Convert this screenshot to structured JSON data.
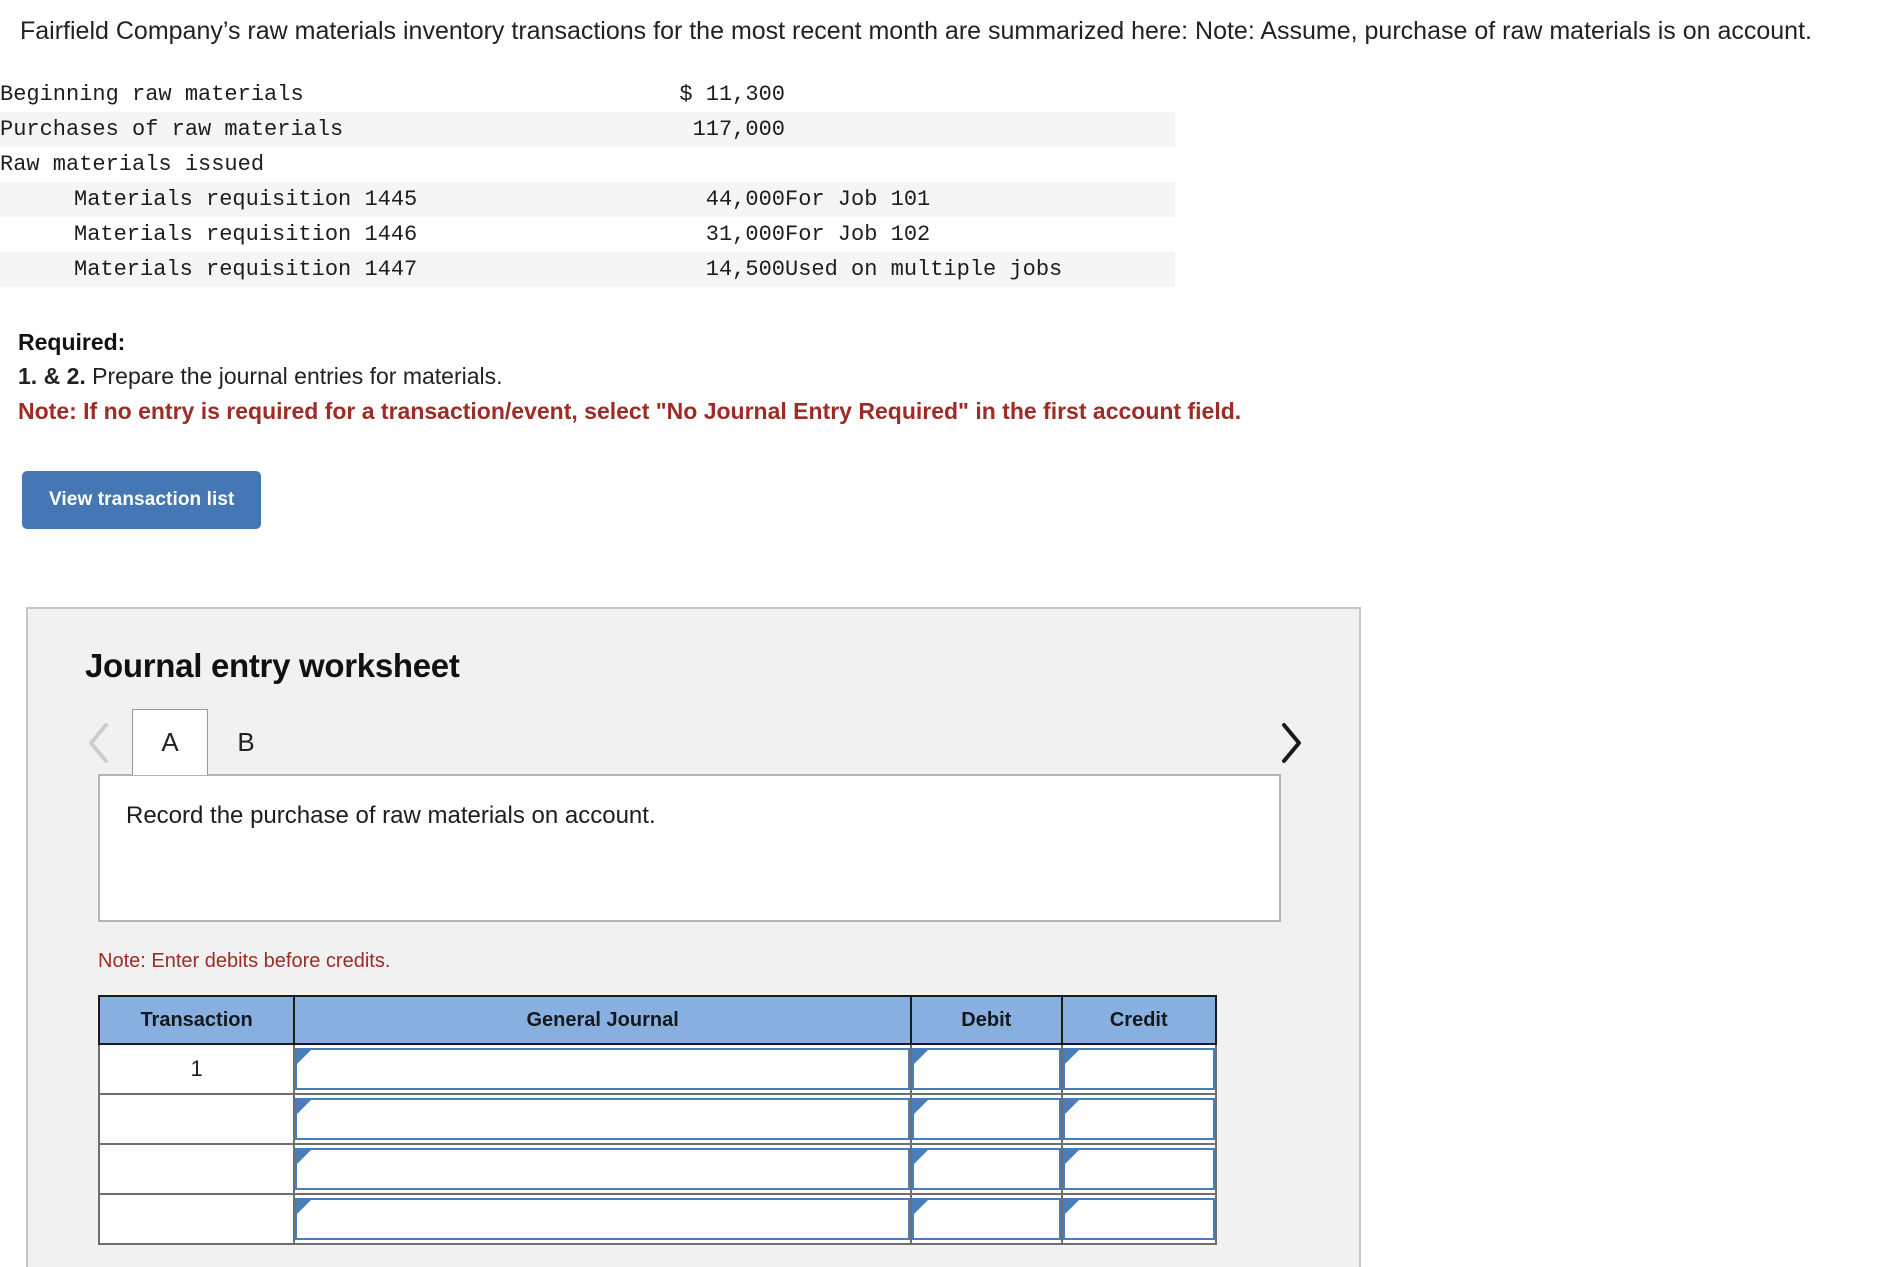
{
  "intro": {
    "paragraph": "Fairfield Company’s raw materials inventory transactions for the most recent month are summarized here: Note: Assume, purchase of raw materials is on account."
  },
  "summary_table": {
    "rows": [
      {
        "label": "Beginning raw materials",
        "indent": false,
        "amount": "$ 11,300",
        "note": "",
        "striped": false
      },
      {
        "label": "Purchases of raw materials",
        "indent": false,
        "amount": "117,000",
        "note": "",
        "striped": true
      },
      {
        "label": "Raw materials issued",
        "indent": false,
        "amount": "",
        "note": "",
        "striped": false
      },
      {
        "label": "Materials requisition 1445",
        "indent": true,
        "amount": "44,000",
        "note": "For Job 101",
        "striped": true
      },
      {
        "label": "Materials requisition 1446",
        "indent": true,
        "amount": "31,000",
        "note": "For Job 102",
        "striped": false
      },
      {
        "label": "Materials requisition 1447",
        "indent": true,
        "amount": "14,500",
        "note": "Used on multiple jobs",
        "striped": true
      }
    ]
  },
  "required": {
    "heading": "Required:",
    "item_number": "1. & 2.",
    "item_text": " Prepare the journal entries for materials.",
    "note": "Note: If no entry is required for a transaction/event, select \"No Journal Entry Required\" in the first account field."
  },
  "toolbar": {
    "view_transaction_list_label": "View transaction list"
  },
  "worksheet": {
    "title": "Journal entry worksheet",
    "tabs": [
      {
        "label": "A",
        "active": true
      },
      {
        "label": "B",
        "active": false
      }
    ],
    "prev_arrow_enabled": false,
    "next_arrow_enabled": true,
    "description": "Record the purchase of raw materials on account.",
    "note_debits": "Note: Enter debits before credits.",
    "table": {
      "headers": [
        "Transaction",
        "General Journal",
        "Debit",
        "Credit"
      ],
      "rows": [
        {
          "transaction": "1",
          "general_journal": "",
          "debit": "",
          "credit": ""
        },
        {
          "transaction": "",
          "general_journal": "",
          "debit": "",
          "credit": ""
        },
        {
          "transaction": "",
          "general_journal": "",
          "debit": "",
          "credit": ""
        },
        {
          "transaction": "",
          "general_journal": "",
          "debit": "",
          "credit": ""
        }
      ]
    }
  },
  "colors": {
    "button_blue": "#4477b4",
    "header_blue": "#87b0e0",
    "input_border_blue": "#4a7ebb",
    "note_red": "#9e2b25",
    "panel_bg": "#f1f1f1"
  }
}
